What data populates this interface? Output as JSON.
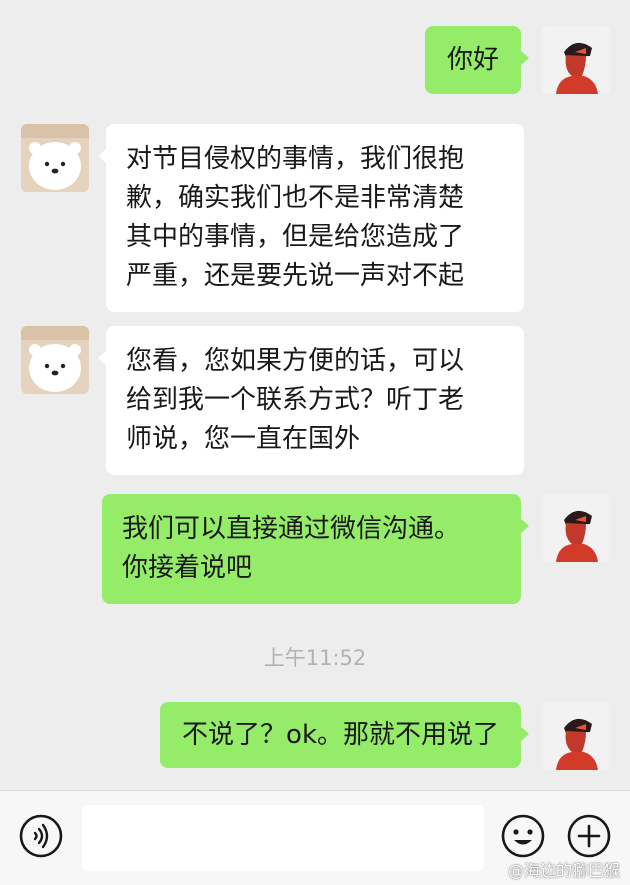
{
  "messages": [
    {
      "text": "你好",
      "avatar_icon": "red-helmet-figure-icon"
    },
    {
      "text": "对节目侵权的事情，我们很抱\n歉，确实我们也不是非常清楚\n其中的事情，但是给您造成了\n严重，还是要先说一声对不起",
      "avatar_icon": "white-bear-icon"
    },
    {
      "text": "您看，您如果方便的话，可以\n给到我一个联系方式？听丁老\n师说，您一直在国外",
      "avatar_icon": "white-bear-icon"
    },
    {
      "text": "我们可以直接通过微信沟通。\n你接着说吧",
      "avatar_icon": "red-helmet-figure-icon"
    },
    {
      "text": "不说了？ok。那就不用说了",
      "avatar_icon": "red-helmet-figure-icon"
    }
  ],
  "timestamp": "上午11:52",
  "input_bar": {
    "voice_icon": "voice-icon",
    "emoji_icon": "emoji-icon",
    "more_icon": "plus-icon"
  },
  "watermark": "@海边的猕巴猴",
  "colors": {
    "background": "#ededed",
    "my_bubble": "#95ec69",
    "other_bubble": "#ffffff",
    "timestamp": "#b2b2b2"
  }
}
